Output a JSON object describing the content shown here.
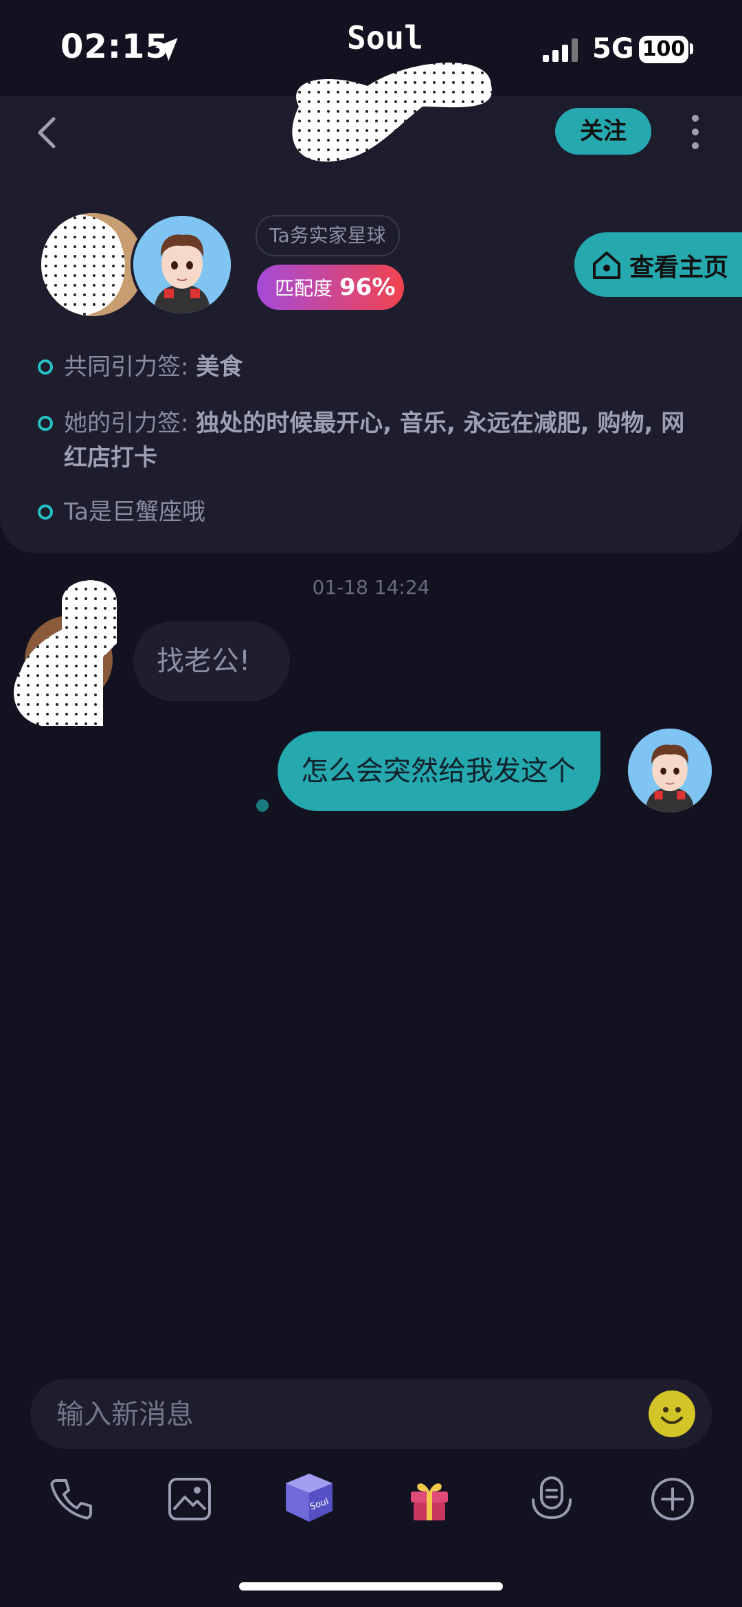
{
  "status_bar": {
    "time": "02:15",
    "app_name": "Soul",
    "network": "5G",
    "battery": "100"
  },
  "nav": {
    "title": "",
    "follow_label": "关注"
  },
  "profile": {
    "planet_tag": "Ta务实家星球",
    "match_label": "匹配度",
    "match_value": "96%",
    "homepage_label": "查看主页",
    "rows": [
      {
        "prefix": "共同引力签:",
        "bold": "美食",
        "rest": ""
      },
      {
        "prefix": "她的引力签:",
        "bold": "独处的时候最开心, 音乐, 永远在减肥, 购物, 网红店打卡",
        "rest": ""
      },
      {
        "prefix": "Ta是巨蟹座哦",
        "bold": "",
        "rest": ""
      }
    ]
  },
  "chat": {
    "timestamp": "01-18 14:24",
    "messages": [
      {
        "from": "her",
        "text": "找老公!"
      },
      {
        "from": "me",
        "text": "怎么会突然给我发这个"
      }
    ]
  },
  "input": {
    "placeholder": "输入新消息"
  },
  "colors": {
    "accent": "#25a8ae",
    "background": "#121221",
    "card": "#1d1d2e"
  },
  "icons": [
    "location-arrow-icon",
    "signal-icon",
    "back-chevron-icon",
    "more-vertical-icon",
    "home-icon",
    "emoji-icon",
    "phone-icon",
    "image-icon",
    "soul-box-icon",
    "gift-icon",
    "voice-icon",
    "plus-circle-icon"
  ]
}
